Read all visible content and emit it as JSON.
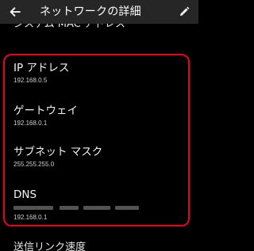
{
  "appbar": {
    "title": "ネットワークの詳細",
    "back_icon": "arrow-left-icon",
    "edit_icon": "pencil-icon"
  },
  "rows": {
    "clipped_top_label": "システム MAC アドレス",
    "bottom_label": "送信リンク速度"
  },
  "network_details": {
    "ip_address": {
      "label": "IP アドレス",
      "value": "192.168.0.5"
    },
    "gateway": {
      "label": "ゲートウェイ",
      "value": "192.168.0.1"
    },
    "subnet_mask": {
      "label": "サブネット マスク",
      "value": "255.255.255.0"
    },
    "dns": {
      "label": "DNS",
      "value": "192.168.0.1"
    }
  },
  "colors": {
    "appbar_bg": "#262626",
    "page_bg": "#000000",
    "highlight_border": "#e8001c"
  }
}
